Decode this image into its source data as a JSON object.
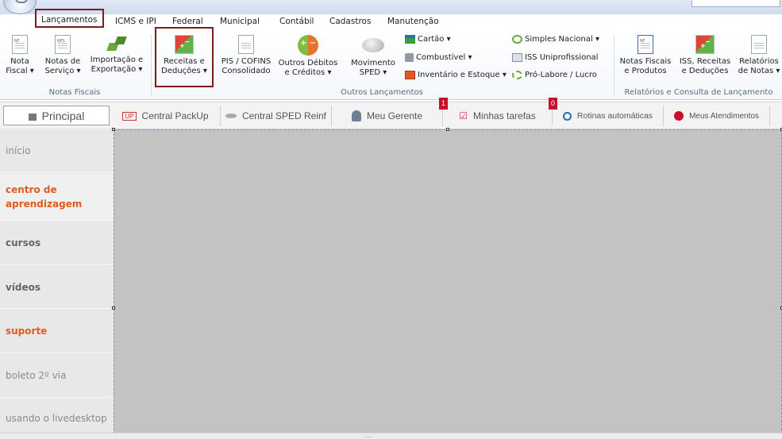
{
  "ribbon_tabs": [
    "Lançamentos",
    "ICMS e IPI",
    "Federal",
    "Municipal",
    "Contábil",
    "Cadastros",
    "Manutenção"
  ],
  "ribbon": {
    "nota_fiscal": {
      "line1": "Nota",
      "line2": "Fiscal ▾",
      "icon_tag": "NF"
    },
    "notas_servico": {
      "line1": "Notas de",
      "line2": "Serviço ▾",
      "icon_tag": "NFS"
    },
    "importacao": {
      "line1": "Importação e",
      "line2": "Exportação ▾"
    },
    "group_notas_fiscais": "Notas Fiscais",
    "receitas": {
      "line1": "Receitas e",
      "line2": "Deduções ▾"
    },
    "pis_cofins": {
      "line1": "PIS / COFINS",
      "line2": "Consolidado"
    },
    "outros_debitos": {
      "line1": "Outros Débitos",
      "line2": "e Créditos ▾"
    },
    "movimento_sped": {
      "line1": "Movimento",
      "line2": "SPED ▾"
    },
    "cartao": "Cartão ▾",
    "combustivel": "Combustível ▾",
    "inventario": "Inventário e Estoque ▾",
    "simples": "Simples Nacional ▾",
    "iss_uniprof": "ISS Uniprofissional",
    "pro_labore": "Pró-Labore / Lucro",
    "group_outros": "Outros Lançamentos",
    "notas_produtos": {
      "line1": "Notas Fiscais",
      "line2": "e Produtos",
      "icon_tag": "NF"
    },
    "iss_receitas": {
      "line1": "ISS, Receitas",
      "line2": "e Deduções"
    },
    "relatorios": {
      "line1": "Relatórios",
      "line2": "de Notas ▾"
    },
    "group_relatorios": "Relatórios e Consulta de Lançamento"
  },
  "app_tabs": {
    "principal": "Principal",
    "packup": "Central PackUp",
    "packup_logo": "UP",
    "sped_reinf": "Central SPED Reinf",
    "gerente": "Meu Gerente",
    "tarefas": "Minhas tarefas",
    "tarefas_badge": "1",
    "rotinas": "Rotinas automáticas",
    "rotinas_badge": "0",
    "atendimentos": "Meus Atendimentos"
  },
  "sidebar": {
    "items": [
      {
        "label": "início"
      },
      {
        "label": "centro de aprendizagem"
      },
      {
        "label": "cursos"
      },
      {
        "label": "vídeos"
      },
      {
        "label": "suporte"
      },
      {
        "label": "boleto 2º via"
      },
      {
        "label": "usando o livedesktop"
      }
    ]
  },
  "colors": {
    "highlight": "#7a1c1c",
    "orange_link": "#e05a1e",
    "main_bg": "#c3c3c3",
    "badge": "#c8102e"
  },
  "bottom_grip": "..."
}
